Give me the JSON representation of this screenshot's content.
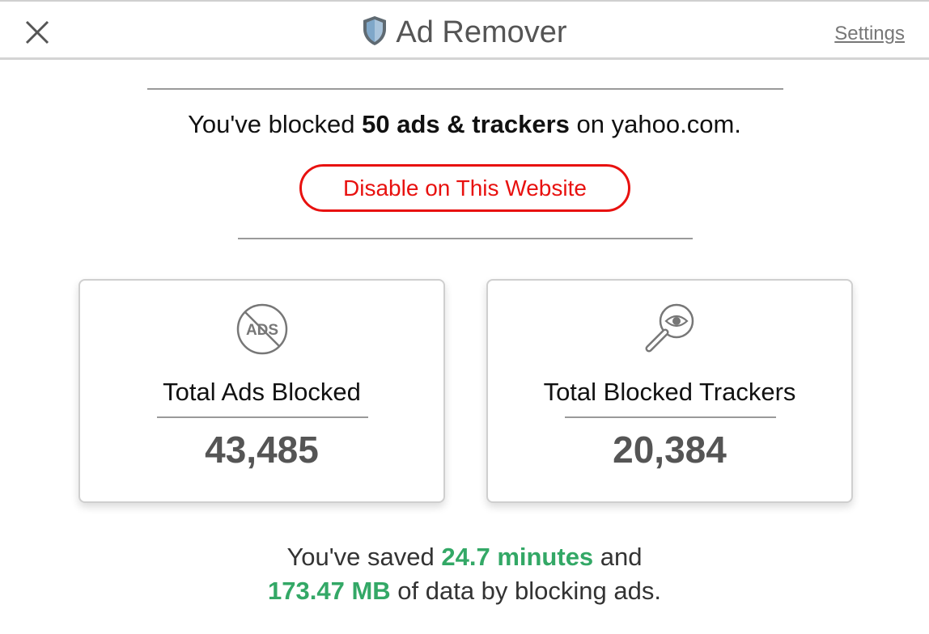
{
  "header": {
    "title": "Ad Remover",
    "settings_label": "Settings",
    "close_icon": "close-icon",
    "logo_icon": "shield-icon"
  },
  "summary": {
    "prefix": "You've blocked ",
    "count_text": "50 ads & trackers",
    "middle": " on ",
    "domain": "yahoo.com",
    "suffix": "."
  },
  "disable_button": {
    "label": "Disable on This Website",
    "color": "#e8110f"
  },
  "cards": [
    {
      "icon": "no-ads-icon",
      "label": "Total Ads Blocked",
      "value": "43,485"
    },
    {
      "icon": "magnifier-eye-icon",
      "label": "Total Blocked Trackers",
      "value": "20,384"
    }
  ],
  "savings": {
    "line1_prefix": "You've saved ",
    "time": "24.7 minutes",
    "line1_suffix": " and",
    "data": "173.47 MB",
    "line2_suffix": " of data by blocking ads.",
    "accent_color": "#33a866"
  }
}
